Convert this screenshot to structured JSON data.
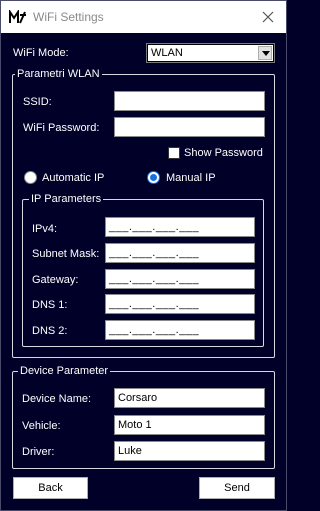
{
  "window": {
    "title": "WiFi Settings"
  },
  "wifi_mode": {
    "label": "WiFi Mode:",
    "selected": "WLAN"
  },
  "wlan_group": {
    "title": "Parametri WLAN",
    "ssid_label": "SSID:",
    "ssid_value": "",
    "password_label": "WiFi Password:",
    "password_value": "",
    "show_password_label": "Show Password",
    "show_password_checked": false,
    "automatic_ip_label": "Automatic IP",
    "manual_ip_label": "Manual IP",
    "ip_mode": "Manual IP"
  },
  "ip_group": {
    "title": "IP Parameters",
    "ipv4_label": "IPv4:",
    "subnet_label": "Subnet Mask:",
    "gateway_label": "Gateway:",
    "dns1_label": "DNS 1:",
    "dns2_label": "DNS 2:",
    "mask": "___.___.___.___"
  },
  "device_group": {
    "title": "Device Parameter",
    "device_name_label": "Device Name:",
    "device_name_value": "Corsaro",
    "vehicle_label": "Vehicle:",
    "vehicle_value": "Moto 1",
    "driver_label": "Driver:",
    "driver_value": "Luke"
  },
  "buttons": {
    "back": "Back",
    "send": "Send"
  },
  "colors": {
    "background": "#000028",
    "radio_accent": "#1a6fe0"
  }
}
